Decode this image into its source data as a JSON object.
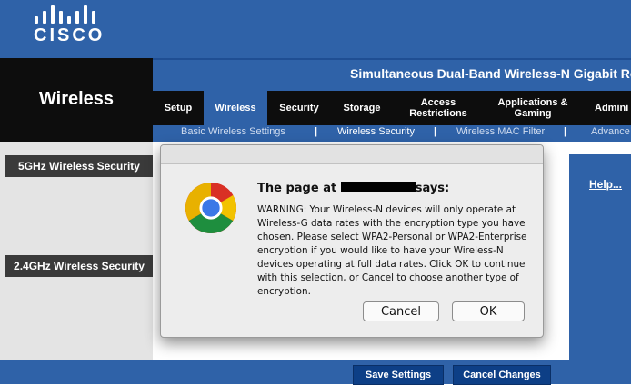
{
  "brand": {
    "logo_text": "CISCO"
  },
  "header": {
    "section_title": "Wireless",
    "product_name": "Simultaneous Dual-Band Wireless-N Gigabit Rou"
  },
  "tabs": [
    {
      "label": "Setup",
      "active": false
    },
    {
      "label": "Wireless",
      "active": true
    },
    {
      "label": "Security",
      "active": false
    },
    {
      "label": "Storage",
      "active": false
    },
    {
      "label": "Access Restrictions",
      "active": false
    },
    {
      "label": "Applications & Gaming",
      "active": false
    },
    {
      "label": "Admini",
      "active": false
    }
  ],
  "subnav": {
    "items": [
      {
        "label": "Basic Wireless Settings",
        "active": false
      },
      {
        "label": "Wireless Security",
        "active": true
      },
      {
        "label": "Wireless MAC Filter",
        "active": false
      },
      {
        "label": "Advance",
        "active": false
      }
    ],
    "separator": "|"
  },
  "sections": {
    "five_ghz": "5GHz Wireless Security",
    "two_ghz": "2.4GHz Wireless Security"
  },
  "help_link": "Help...",
  "footer": {
    "save_label": "Save Settings",
    "cancel_label": "Cancel Changes"
  },
  "dialog": {
    "title_prefix": "The page at",
    "title_suffix": "says:",
    "message": "WARNING: Your Wireless-N devices will only operate at Wireless-G data rates with the encryption type you have chosen.  Please select WPA2-Personal or WPA2-Enterprise encryption if you would like to have your Wireless-N devices operating at full data rates.  Click OK to continue with this selection, or Cancel to choose another type of encryption.",
    "cancel_label": "Cancel",
    "ok_label": "OK",
    "icon": "chrome-icon"
  },
  "colors": {
    "cisco_blue": "#2f62a8",
    "dark": "#0d0d0d",
    "button_blue": "#0d3f86"
  }
}
